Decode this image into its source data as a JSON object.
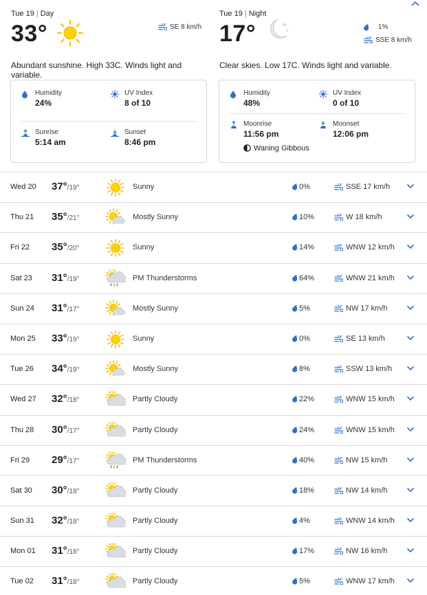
{
  "today": {
    "day": {
      "date": "Tue 19",
      "period": "Day",
      "temp": "33°",
      "icon": "sun-icon",
      "wind": "SE 8 km/h",
      "description": "Abundant sunshine. High 33C. Winds light and variable.",
      "humidity_label": "Humidity",
      "humidity": "24%",
      "uv_label": "UV Index",
      "uv": "8 of 10",
      "sunrise_label": "Sunrise",
      "sunrise": "5:14 am",
      "sunset_label": "Sunset",
      "sunset": "8:46 pm"
    },
    "night": {
      "date": "Tue 19",
      "period": "Night",
      "temp": "17°",
      "icon": "moon-stars-icon",
      "precip": "1%",
      "wind": "SSE 8 km/h",
      "description": "Clear skies. Low 17C. Winds light and variable.",
      "humidity_label": "Humidity",
      "humidity": "48%",
      "uv_label": "UV Index",
      "uv": "0 of 10",
      "moonrise_label": "Moonrise",
      "moonrise": "11:56 pm",
      "moonset_label": "Moonset",
      "moonset": "12:06 pm",
      "moon_phase": "Waning Gibbous"
    }
  },
  "forecast": [
    {
      "date": "Wed 20",
      "hi": "37°",
      "lo": "/19°",
      "icon": "sunny",
      "condition": "Sunny",
      "precip": "0%",
      "wind": "SSE 17 km/h"
    },
    {
      "date": "Thu 21",
      "hi": "35°",
      "lo": "/21°",
      "icon": "mostly-sunny",
      "condition": "Mostly Sunny",
      "precip": "10%",
      "wind": "W 18 km/h"
    },
    {
      "date": "Fri 22",
      "hi": "35°",
      "lo": "/20°",
      "icon": "sunny",
      "condition": "Sunny",
      "precip": "14%",
      "wind": "WNW 12 km/h"
    },
    {
      "date": "Sat 23",
      "hi": "31°",
      "lo": "/19°",
      "icon": "thunderstorm",
      "condition": "PM Thunderstorms",
      "precip": "64%",
      "wind": "WNW 21 km/h"
    },
    {
      "date": "Sun 24",
      "hi": "31°",
      "lo": "/17°",
      "icon": "mostly-sunny",
      "condition": "Mostly Sunny",
      "precip": "5%",
      "wind": "NW 17 km/h"
    },
    {
      "date": "Mon 25",
      "hi": "33°",
      "lo": "/19°",
      "icon": "sunny",
      "condition": "Sunny",
      "precip": "0%",
      "wind": "SE 13 km/h"
    },
    {
      "date": "Tue 26",
      "hi": "34°",
      "lo": "/19°",
      "icon": "mostly-sunny",
      "condition": "Mostly Sunny",
      "precip": "8%",
      "wind": "SSW 13 km/h"
    },
    {
      "date": "Wed 27",
      "hi": "32°",
      "lo": "/18°",
      "icon": "partly-cloudy",
      "condition": "Partly Cloudy",
      "precip": "22%",
      "wind": "WNW 15 km/h"
    },
    {
      "date": "Thu 28",
      "hi": "30°",
      "lo": "/17°",
      "icon": "partly-cloudy",
      "condition": "Partly Cloudy",
      "precip": "24%",
      "wind": "WNW 15 km/h"
    },
    {
      "date": "Fri 29",
      "hi": "29°",
      "lo": "/17°",
      "icon": "thunderstorm",
      "condition": "PM Thunderstorms",
      "precip": "40%",
      "wind": "NW 15 km/h"
    },
    {
      "date": "Sat 30",
      "hi": "30°",
      "lo": "/18°",
      "icon": "partly-cloudy",
      "condition": "Partly Cloudy",
      "precip": "18%",
      "wind": "NW 14 km/h"
    },
    {
      "date": "Sun 31",
      "hi": "32°",
      "lo": "/18°",
      "icon": "partly-cloudy",
      "condition": "Partly Cloudy",
      "precip": "4%",
      "wind": "WNW 14 km/h"
    },
    {
      "date": "Mon 01",
      "hi": "31°",
      "lo": "/18°",
      "icon": "partly-cloudy",
      "condition": "Partly Cloudy",
      "precip": "17%",
      "wind": "NW 16 km/h"
    },
    {
      "date": "Tue 02",
      "hi": "31°",
      "lo": "/18°",
      "icon": "partly-cloudy",
      "condition": "Partly Cloudy",
      "precip": "5%",
      "wind": "WNW 17 km/h"
    }
  ],
  "colors": {
    "accent": "#2b6fd6",
    "sun": "#f6c400",
    "cloud": "#d9dde2",
    "border": "#d6d6d6"
  }
}
